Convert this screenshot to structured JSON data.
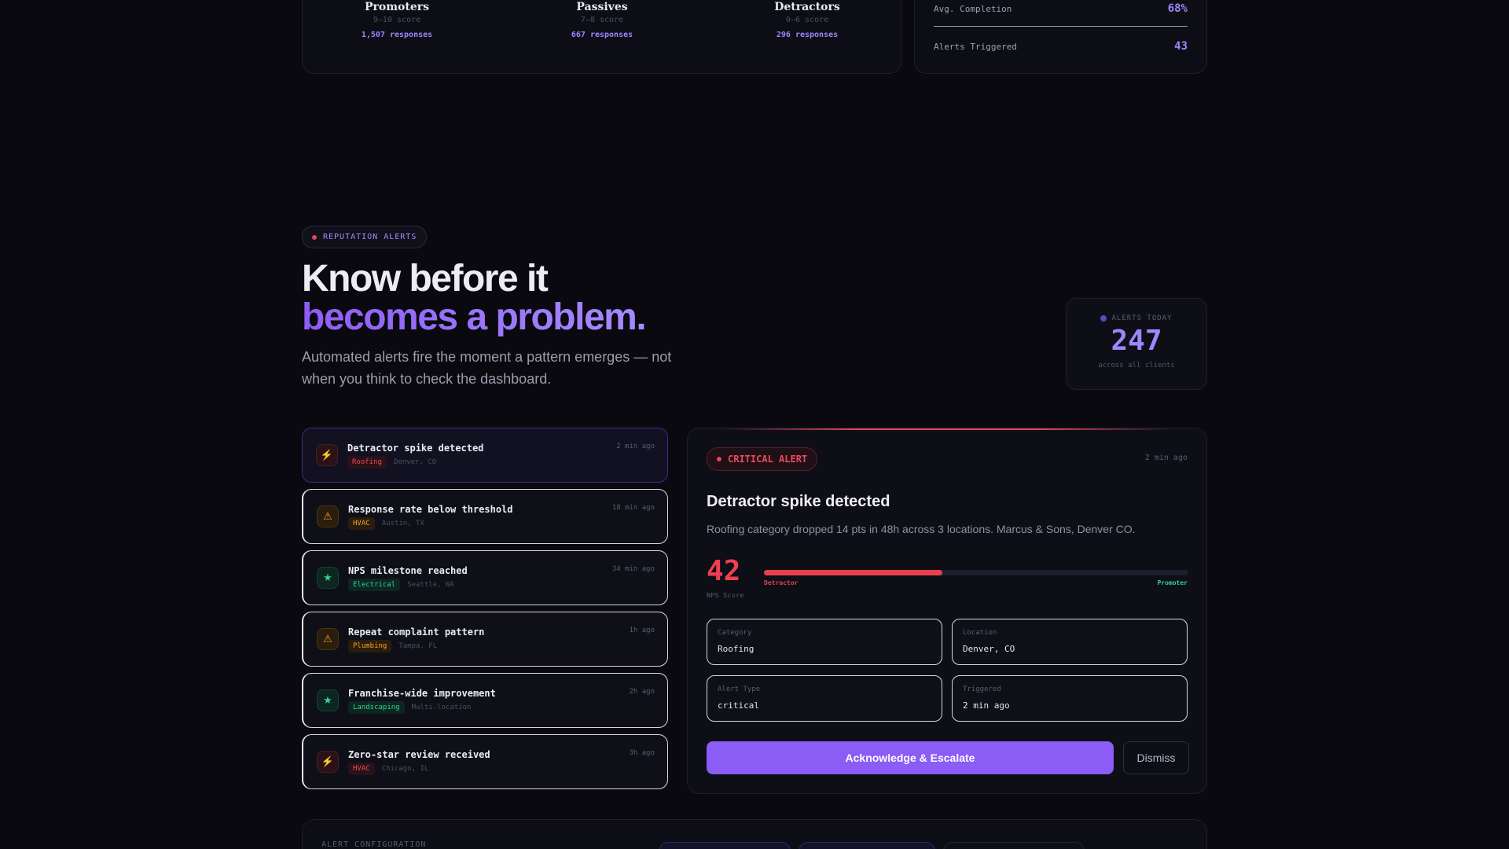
{
  "segments": [
    {
      "title": "Promoters",
      "score": "9–10 score",
      "responses": "1,507 responses"
    },
    {
      "title": "Passives",
      "score": "7–8 score",
      "responses": "667 responses"
    },
    {
      "title": "Detractors",
      "score": "0–6 score",
      "responses": "296 responses"
    }
  ],
  "stats": [
    {
      "label": "Avg. Completion",
      "value": "68%"
    },
    {
      "label": "Alerts Triggered",
      "value": "43"
    }
  ],
  "hero": {
    "badge": "REPUTATION ALERTS",
    "title_line1": "Know before it",
    "title_line2": "becomes a problem.",
    "lead": "Automated alerts fire the moment a pattern emerges — not when you think to check the dashboard."
  },
  "today": {
    "label": "ALERTS TODAY",
    "value": "247",
    "sub": "across all clients"
  },
  "alerts": [
    {
      "icon": "lightning-icon",
      "glyph": "⚡",
      "title": "Detractor spike detected",
      "tag": "Roofing",
      "location": "Denver, CO",
      "time": "2 min ago",
      "tone": "red"
    },
    {
      "icon": "warning-icon",
      "glyph": "⚠",
      "title": "Response rate below threshold",
      "tag": "HVAC",
      "location": "Austin, TX",
      "time": "18 min ago",
      "tone": "amber"
    },
    {
      "icon": "star-icon",
      "glyph": "★",
      "title": "NPS milestone reached",
      "tag": "Electrical",
      "location": "Seattle, WA",
      "time": "34 min ago",
      "tone": "green"
    },
    {
      "icon": "warning-icon",
      "glyph": "⚠",
      "title": "Repeat complaint pattern",
      "tag": "Plumbing",
      "location": "Tampa, FL",
      "time": "1h ago",
      "tone": "amber"
    },
    {
      "icon": "star-icon",
      "glyph": "★",
      "title": "Franchise-wide improvement",
      "tag": "Landscaping",
      "location": "Multi-location",
      "time": "2h ago",
      "tone": "green"
    },
    {
      "icon": "lightning-icon",
      "glyph": "⚡",
      "title": "Zero-star review received",
      "tag": "HVAC",
      "location": "Chicago, IL",
      "time": "3h ago",
      "tone": "red"
    }
  ],
  "detail": {
    "badge": "CRITICAL ALERT",
    "time": "2 min ago",
    "title": "Detractor spike detected",
    "description": "Roofing category dropped 14 pts in 48h across 3 locations. Marcus & Sons, Denver CO.",
    "nps_value": "42",
    "nps_caption": "NPS Score",
    "nps_fraction": 0.42,
    "scale_left": "Detractor",
    "scale_right": "Promoter",
    "fields": [
      {
        "label": "Category",
        "value": "Roofing"
      },
      {
        "label": "Location",
        "value": "Denver, CO"
      },
      {
        "label": "Alert Type",
        "value": "critical"
      },
      {
        "label": "Triggered",
        "value": "2 min ago"
      }
    ],
    "primary_label": "Acknowledge & Escalate",
    "secondary_label": "Dismiss"
  },
  "config": {
    "heading": "ALERT CONFIGURATION"
  },
  "colors": {
    "accent": "#8b5cf6",
    "critical": "#ee4050",
    "positive": "#2fd29a",
    "warning": "#f0a326"
  }
}
